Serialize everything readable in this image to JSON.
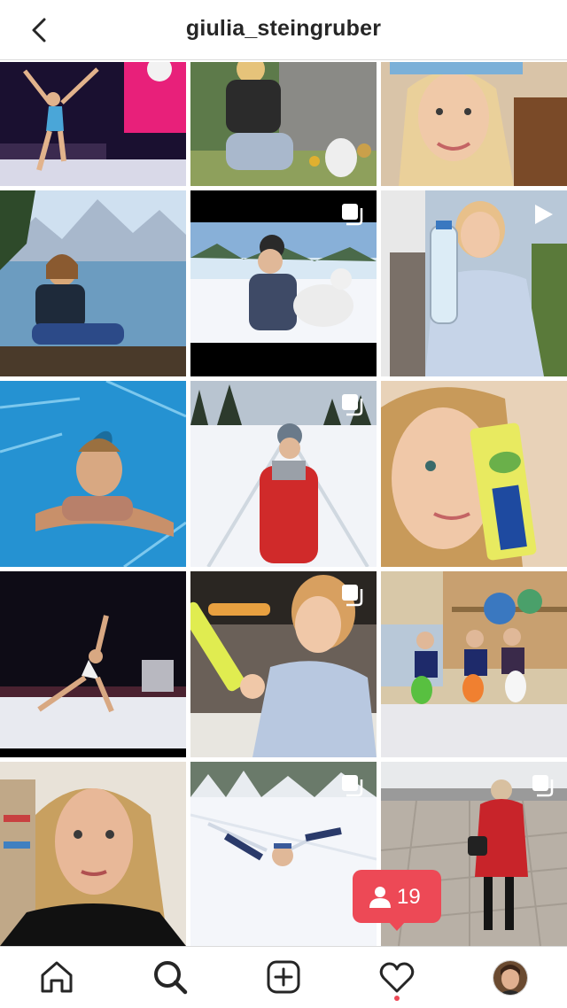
{
  "header": {
    "username": "giulia_steingruber"
  },
  "grid": {
    "posts": [
      {
        "id": 1,
        "scene": "gymnastics arena",
        "multi": false,
        "video": false
      },
      {
        "id": 2,
        "scene": "easter garden",
        "multi": false,
        "video": false
      },
      {
        "id": 3,
        "scene": "selfie",
        "multi": false,
        "video": false
      },
      {
        "id": 4,
        "scene": "lake and mountains",
        "multi": false,
        "video": false
      },
      {
        "id": 5,
        "scene": "snow with dog",
        "multi": true,
        "video": false
      },
      {
        "id": 6,
        "scene": "water bottle",
        "multi": false,
        "video": true
      },
      {
        "id": 7,
        "scene": "pool",
        "multi": false,
        "video": false
      },
      {
        "id": 8,
        "scene": "snow field red jacket",
        "multi": true,
        "video": false
      },
      {
        "id": 9,
        "scene": "veganaise tube",
        "multi": false,
        "video": false
      },
      {
        "id": 10,
        "scene": "floor routine",
        "multi": false,
        "video": false
      },
      {
        "id": 11,
        "scene": "kitchen product",
        "multi": true,
        "video": false
      },
      {
        "id": 12,
        "scene": "gym with toys",
        "multi": false,
        "video": false
      },
      {
        "id": 13,
        "scene": "portrait",
        "multi": false,
        "video": false
      },
      {
        "id": 14,
        "scene": "snow angel",
        "multi": true,
        "video": false
      },
      {
        "id": 15,
        "scene": "parking lot",
        "multi": true,
        "video": false
      }
    ]
  },
  "notification": {
    "follower_count": "19",
    "icon": "person-icon"
  },
  "tabbar": {
    "items": [
      {
        "name": "home",
        "icon": "home-icon"
      },
      {
        "name": "search",
        "icon": "search-icon"
      },
      {
        "name": "new-post",
        "icon": "plus-square-icon"
      },
      {
        "name": "activity",
        "icon": "heart-icon"
      },
      {
        "name": "profile",
        "icon": "avatar"
      }
    ]
  },
  "colors": {
    "notification": "#ed4956",
    "text": "#262626",
    "divider": "#dbdbdb"
  }
}
